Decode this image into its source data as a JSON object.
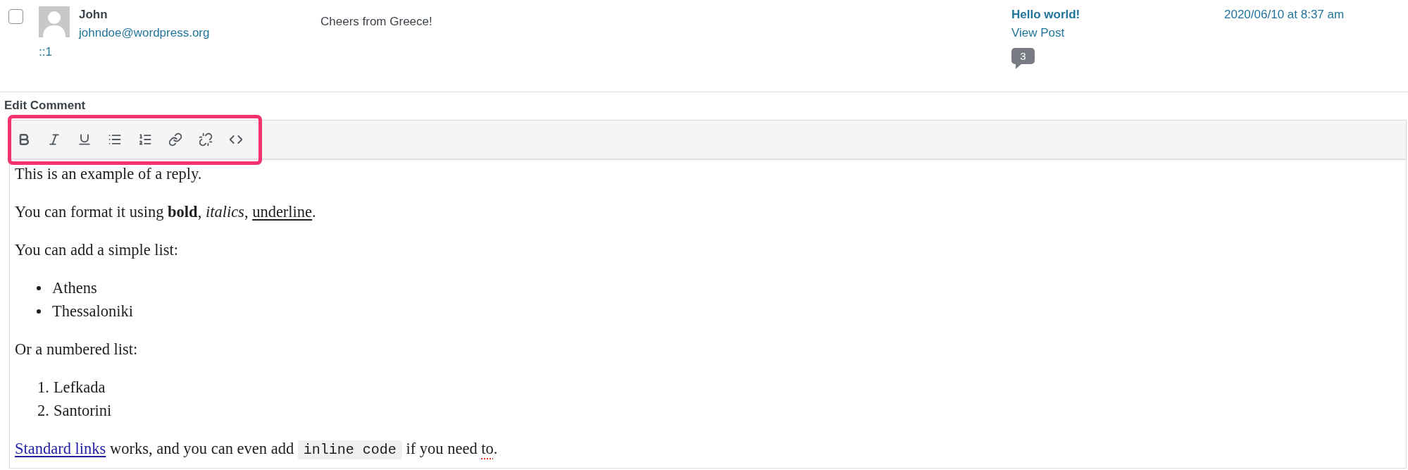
{
  "comment_row": {
    "checkbox": {
      "checked": false
    },
    "author": {
      "name": "John",
      "email": "johndoe@wordpress.org",
      "ip": "::1"
    },
    "comment": "Cheers from Greece!",
    "in_response_to": {
      "post_title": "Hello world!",
      "view_link": "View Post",
      "comment_count": "3"
    },
    "submitted_on": "2020/06/10 at 8:37 am"
  },
  "edit_comment": {
    "title": "Edit Comment",
    "toolbar": {
      "highlighted": true,
      "buttons": [
        {
          "kind": "bold"
        },
        {
          "kind": "italic"
        },
        {
          "kind": "underline"
        },
        {
          "kind": "bulleted_list"
        },
        {
          "kind": "numbered_list"
        },
        {
          "kind": "link"
        },
        {
          "kind": "unlink"
        },
        {
          "kind": "code"
        }
      ]
    },
    "content": [
      {
        "kind": "paragraph",
        "segments": [
          {
            "kind": "text",
            "text": "This is an example of a reply."
          }
        ]
      },
      {
        "kind": "paragraph",
        "segments": [
          {
            "kind": "text",
            "text": "You can format it using "
          },
          {
            "kind": "bold",
            "text": "bold"
          },
          {
            "kind": "text",
            "text": ", "
          },
          {
            "kind": "italic",
            "text": "italics"
          },
          {
            "kind": "text",
            "text": ", "
          },
          {
            "kind": "underline",
            "text": "underline"
          },
          {
            "kind": "text",
            "text": "."
          }
        ]
      },
      {
        "kind": "paragraph",
        "segments": [
          {
            "kind": "text",
            "text": "You can add a simple list:"
          }
        ]
      },
      {
        "kind": "bulleted_list",
        "items": [
          {
            "text": "Athens"
          },
          {
            "text": "Thessaloniki"
          }
        ]
      },
      {
        "kind": "paragraph",
        "segments": [
          {
            "kind": "text",
            "text": "Or a numbered list:"
          }
        ]
      },
      {
        "kind": "numbered_list",
        "items": [
          {
            "number": "1.",
            "text": "Lefkada"
          },
          {
            "number": "2.",
            "text": "Santorini"
          }
        ]
      },
      {
        "kind": "paragraph",
        "segments": [
          {
            "kind": "link",
            "text": "Standard links"
          },
          {
            "kind": "text",
            "text": " works, and you can even add "
          },
          {
            "kind": "code",
            "text": "inline code"
          },
          {
            "kind": "text",
            "text": " if you need "
          },
          {
            "kind": "misspelled",
            "text": "to"
          },
          {
            "kind": "text",
            "text": "."
          }
        ]
      }
    ]
  }
}
